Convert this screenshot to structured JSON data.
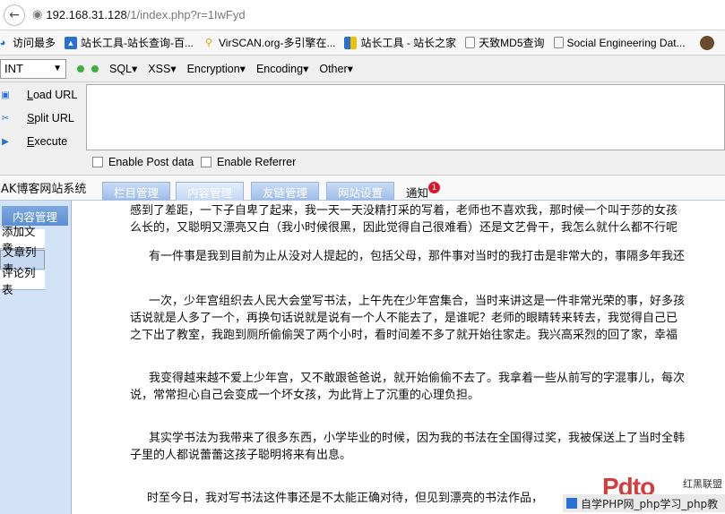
{
  "browser": {
    "url_host": "192.168.31.128",
    "url_path": "/1/index.php?r=1IwFyd"
  },
  "bookmarks": [
    {
      "label": "访问最多",
      "icon": "ie-icon"
    },
    {
      "label": "站长工具-站长查询-百...",
      "icon": "blue-doc-icon"
    },
    {
      "label": "VirSCAN.org-多引擎在...",
      "icon": "key-icon"
    },
    {
      "label": "站长工具 - 站长之家",
      "icon": "bar-icon"
    },
    {
      "label": "天致MD5查询",
      "icon": "doc-icon"
    },
    {
      "label": "Social Engineering Dat...",
      "icon": "doc-icon"
    }
  ],
  "hackbar": {
    "select_value": "INT",
    "menus": [
      "SQL",
      "XSS",
      "Encryption",
      "Encoding",
      "Other"
    ],
    "actions": [
      {
        "key": "L",
        "rest": "oad URL"
      },
      {
        "key": "S",
        "rest": "plit URL"
      },
      {
        "key": "E",
        "rest": "xecute"
      }
    ],
    "enable_post": "Enable Post data",
    "enable_referrer": "Enable Referrer"
  },
  "site": {
    "title": "AK博客网站系统",
    "tabs": [
      "栏目管理",
      "内容管理",
      "友链管理",
      "网站设置"
    ],
    "notice_label": "通知",
    "notice_count": "1"
  },
  "sidebar": {
    "header": "内容管理",
    "items": [
      "添加文章",
      "文章列表",
      "评论列表"
    ]
  },
  "article": {
    "lines": [
      "感到了差距，一下子自卑了起来，我一天一天没精打采的写着，老师也不喜欢我，那时候一个叫于莎的女孩",
      "么长的，又聪明又漂亮又白（我小时候很黑，因此觉得自己很难看）还是文艺骨干，我怎么就什么都不行呢",
      "有一件事是我到目前为止从没对人提起的，包括父母，那件事对当时的我打击是非常大的，事隔多年我还",
      "一次，少年宫组织去人民大会堂写书法，上午先在少年宫集合，当时来讲这是一件非常光荣的事，好多孩",
      "话说就是人多了一个，再换句话说就是说有一个人不能去了，是谁呢？老师的眼睛转来转去，我觉得自己已",
      "之下出了教室，我跑到厕所偷偷哭了两个小时，看时间差不多了就开始往家走。我兴高采烈的回了家，幸福",
      "我变得越来越不爱上少年宫，又不敢跟爸爸说，就开始偷偷不去了。我拿着一些从前写的字混事儿，每次",
      "说，常常担心自己会变成一个坏女孩，为此背上了沉重的心理负担。",
      "其实学书法为我带来了很多东西，小学毕业的时候，因为我的书法在全国得过奖，我被保送上了当时全韩",
      "子里的人都说蕾蕾这孩子聪明将来有出息。",
      "时至今日，我对写书法这件事还是不太能正确对待，但见到漂亮的书法作品，"
    ]
  },
  "watermark": {
    "logo": "Pdto",
    "tag": "红黑联盟",
    "bar_text": "自学PHP网_php学习_php教"
  }
}
